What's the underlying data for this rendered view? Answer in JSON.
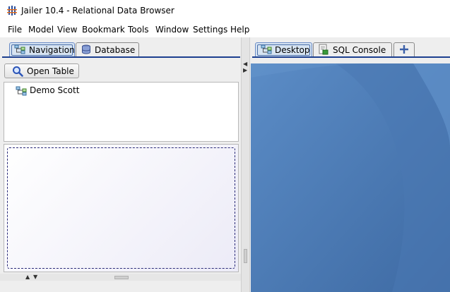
{
  "window": {
    "title": "Jailer 10.4 - Relational Data Browser"
  },
  "menu": [
    "File",
    "Model",
    "View",
    "Bookmark",
    "Tools",
    "Window",
    "Settings",
    "Help"
  ],
  "left_tabs": [
    {
      "label": "Navigation",
      "icon": "navigation-tree-icon",
      "selected": true
    },
    {
      "label": "Database",
      "icon": "database-icon",
      "selected": false
    }
  ],
  "open_table": {
    "label": "Open Table",
    "icon": "magnifier-icon"
  },
  "tree": {
    "items": [
      {
        "label": "Demo Scott",
        "icon": "tree-node-icon"
      }
    ]
  },
  "right_tabs": [
    {
      "label": "Desktop",
      "icon": "navigation-tree-icon",
      "selected": true
    },
    {
      "label": "SQL Console",
      "icon": "sql-console-icon",
      "selected": false
    },
    {
      "label": "",
      "icon": "plus-icon",
      "selected": false
    }
  ],
  "colors": {
    "accent": "#1c3f8f",
    "desktop": "#4e7fba",
    "drop_dash": "#2a2a78"
  }
}
